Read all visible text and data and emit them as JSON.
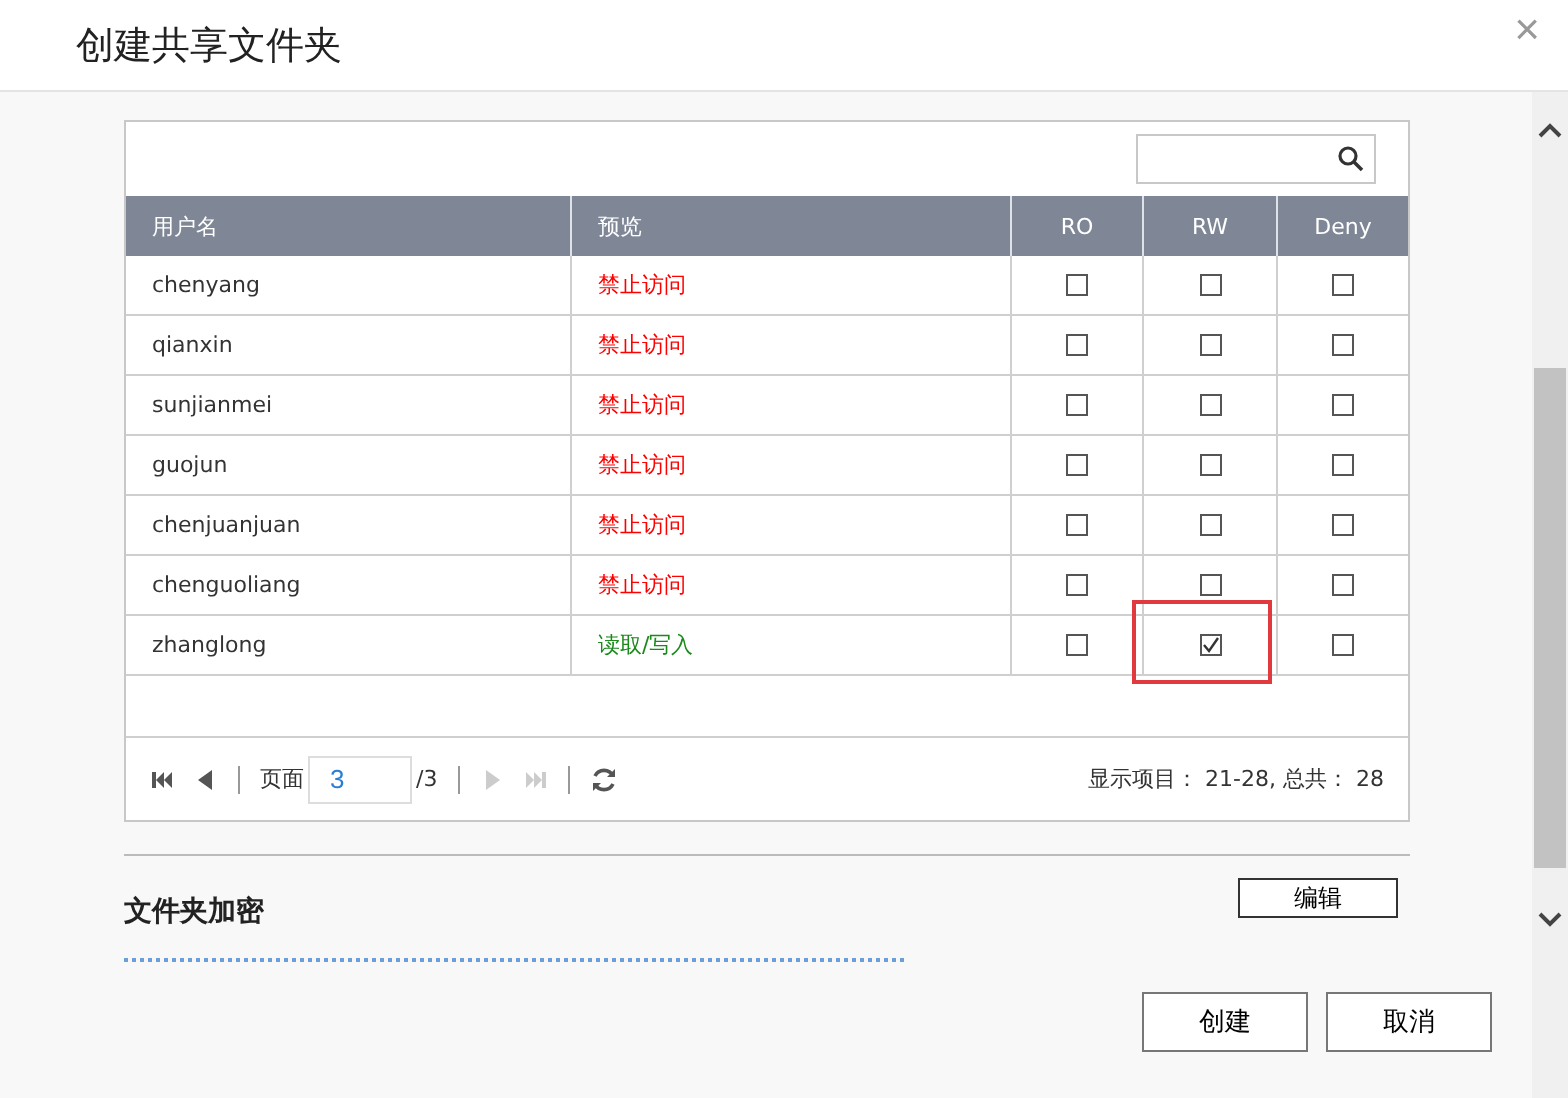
{
  "window": {
    "title": "创建共享文件夹",
    "close": "×"
  },
  "table": {
    "columns": [
      "用户名",
      "预览",
      "RO",
      "RW",
      "Deny"
    ],
    "rows": [
      {
        "user": "chenyang",
        "preview": "禁止访问",
        "kind": "denied",
        "ro": false,
        "rw": false,
        "deny": false,
        "highlighted": false
      },
      {
        "user": "qianxin",
        "preview": "禁止访问",
        "kind": "denied",
        "ro": false,
        "rw": false,
        "deny": false,
        "highlighted": false
      },
      {
        "user": "sunjianmei",
        "preview": "禁止访问",
        "kind": "denied",
        "ro": false,
        "rw": false,
        "deny": false,
        "highlighted": false
      },
      {
        "user": "guojun",
        "preview": "禁止访问",
        "kind": "denied",
        "ro": false,
        "rw": false,
        "deny": false,
        "highlighted": false
      },
      {
        "user": "chenjuanjuan",
        "preview": "禁止访问",
        "kind": "denied",
        "ro": false,
        "rw": false,
        "deny": false,
        "highlighted": false
      },
      {
        "user": "chenguoliang",
        "preview": "禁止访问",
        "kind": "denied",
        "ro": false,
        "rw": false,
        "deny": false,
        "highlighted": false
      },
      {
        "user": "zhanglong",
        "preview": "读取/写入",
        "kind": "readwrite",
        "ro": false,
        "rw": true,
        "deny": false,
        "highlighted": true
      }
    ]
  },
  "pager": {
    "page_label": "页面",
    "page": "3",
    "total": "/3",
    "summary": "显示项目： 21-28, 总共： 28"
  },
  "encryption": {
    "title": "文件夹加密",
    "edit_button": "编辑"
  },
  "buttons": [
    "创建",
    "取消"
  ]
}
